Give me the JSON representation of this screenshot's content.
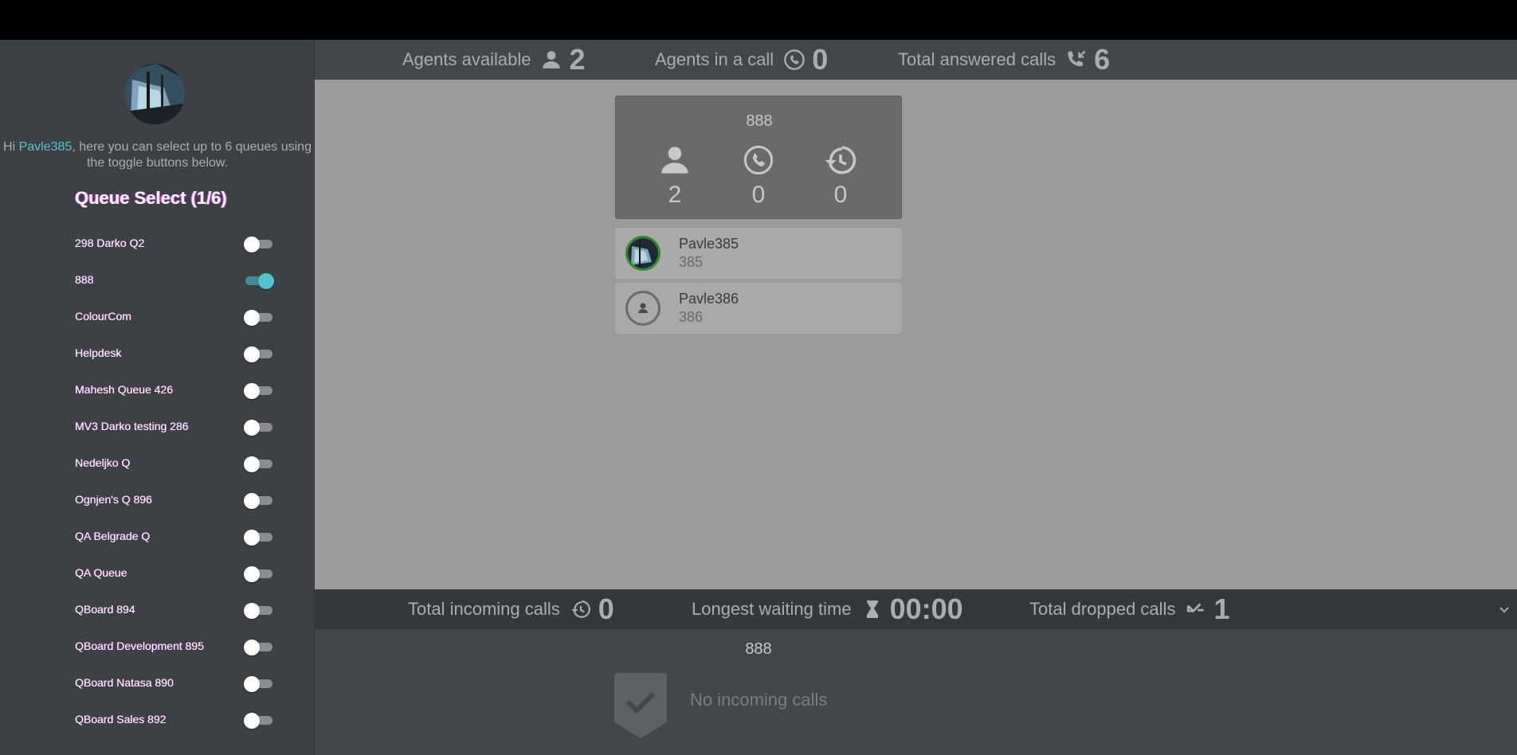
{
  "sidebar": {
    "greeting_prefix": "Hi ",
    "username": "Pavle385",
    "greeting_suffix": ", here you can select up to 6 queues using the toggle buttons below.",
    "queue_select_title": "Queue Select (1/6)",
    "queues": [
      {
        "name": "298 Darko Q2",
        "enabled": false
      },
      {
        "name": "888",
        "enabled": true
      },
      {
        "name": "ColourCom",
        "enabled": false
      },
      {
        "name": "Helpdesk",
        "enabled": false
      },
      {
        "name": "Mahesh Queue 426",
        "enabled": false
      },
      {
        "name": "MV3 Darko testing 286",
        "enabled": false
      },
      {
        "name": "Nedeljko Q",
        "enabled": false
      },
      {
        "name": "Ognjen's Q 896",
        "enabled": false
      },
      {
        "name": "QA Belgrade Q",
        "enabled": false
      },
      {
        "name": "QA Queue",
        "enabled": false
      },
      {
        "name": "QBoard 894",
        "enabled": false
      },
      {
        "name": "QBoard Development 895",
        "enabled": false
      },
      {
        "name": "QBoard Natasa 890",
        "enabled": false
      },
      {
        "name": "QBoard Sales 892",
        "enabled": false
      }
    ]
  },
  "top_stats": {
    "agents_available": {
      "label": "Agents available",
      "value": "2",
      "icon": "person-icon"
    },
    "agents_in_call": {
      "label": "Agents in a call",
      "value": "0",
      "icon": "phone-icon"
    },
    "total_answered": {
      "label": "Total answered calls",
      "value": "6",
      "icon": "phone-incoming-icon"
    }
  },
  "queue_card": {
    "name": "888",
    "agents": "2",
    "in_call": "0",
    "history": "0"
  },
  "agents": [
    {
      "name": "Pavle385",
      "ext": "385",
      "status": "available"
    },
    {
      "name": "Pavle386",
      "ext": "386",
      "status": "offline"
    }
  ],
  "bottom_stats": {
    "incoming": {
      "label": "Total incoming calls",
      "value": "0",
      "icon": "history-icon"
    },
    "longest_wait": {
      "label": "Longest waiting time",
      "value": "00:00",
      "icon": "hourglass-icon"
    },
    "dropped": {
      "label": "Total dropped calls",
      "value": "1",
      "icon": "missed-call-icon"
    }
  },
  "incoming": {
    "queue_name": "888",
    "empty_text": "No incoming calls"
  },
  "colors": {
    "accent": "#53c3d0",
    "sidebar_bg": "#3d4146",
    "main_bg": "#9b9b9b"
  }
}
